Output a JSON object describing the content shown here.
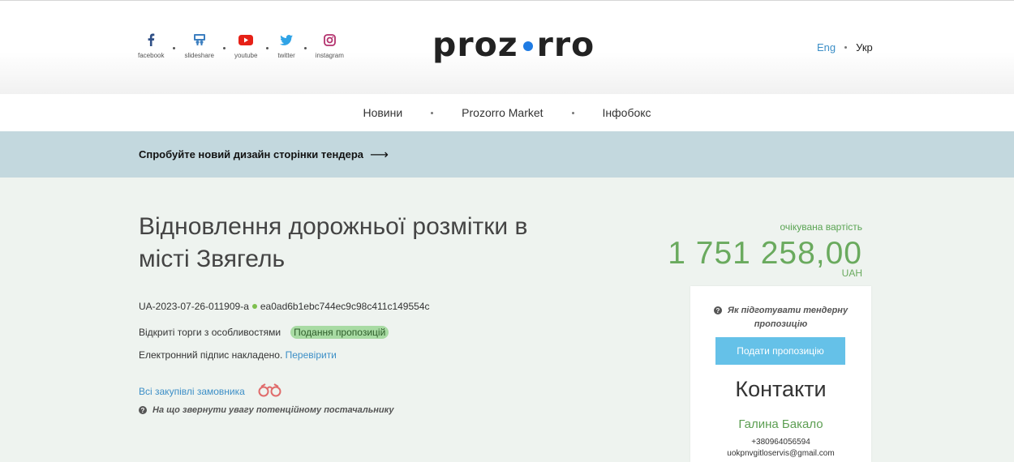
{
  "social": [
    {
      "label": "facebook",
      "icon": "facebook-icon"
    },
    {
      "label": "slideshare",
      "icon": "slideshare-icon"
    },
    {
      "label": "youtube",
      "icon": "youtube-icon"
    },
    {
      "label": "twitter",
      "icon": "twitter-icon"
    },
    {
      "label": "instagram",
      "icon": "instagram-icon"
    }
  ],
  "logo": {
    "left": "proz",
    "right": "rro"
  },
  "lang": {
    "eng": "Eng",
    "ukr": "Укр"
  },
  "nav": {
    "news": "Новини",
    "market": "Prozorro Market",
    "infobox": "Інфобокс"
  },
  "banner": {
    "text": "Спробуйте новий дизайн сторінки тендера",
    "arrow": "⟶"
  },
  "tender": {
    "title": "Відновлення дорожньої розмітки в місті Звягель",
    "id": "UA-2023-07-26-011909-a",
    "hash": "ea0ad6b1ebc744ec9c98c411c149554c",
    "procedure": "Відкриті торги з особливостями",
    "status": "Подання пропозицій",
    "signature_text": "Електронний підпис накладено.",
    "signature_link": "Перевірити",
    "all_purchases": "Всі закупівлі замовника",
    "attention": "На що звернути увагу потенційному постачальнику"
  },
  "expected": {
    "label": "очікувана вартість",
    "value": "1 751 258,00",
    "currency": "UAH"
  },
  "card": {
    "howto_line1": "Як підготувати тендерну",
    "howto_line2": "пропозицію",
    "submit": "Подати пропозицію",
    "contacts_title": "Контакти",
    "name": "Галина Бакало",
    "phone": "+380964056594",
    "email": "uokpnvgitloservis@gmail.com"
  },
  "colors": {
    "accent_blue": "#3d8fc7",
    "green": "#6aaa5e",
    "banner": "#c3d8de",
    "button": "#65c1e8"
  }
}
